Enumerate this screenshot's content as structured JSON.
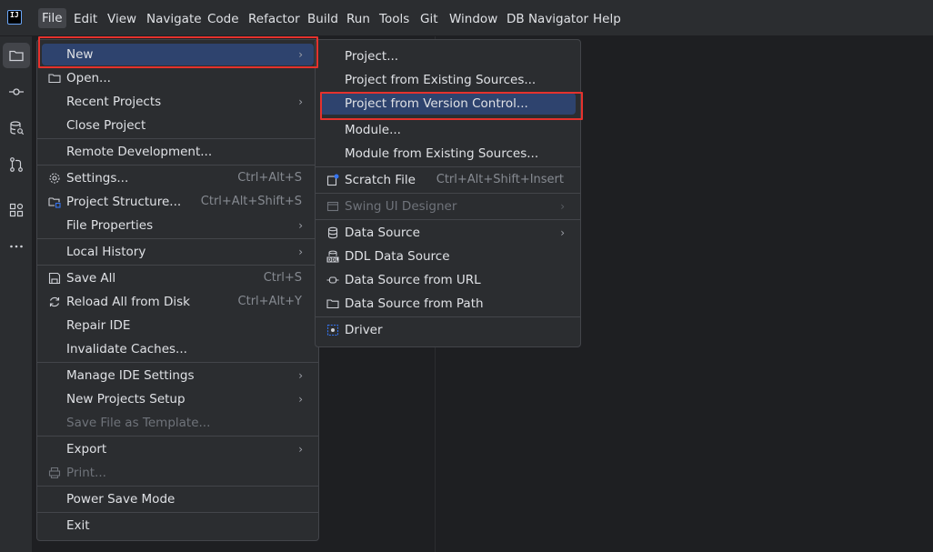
{
  "menubar": {
    "logo": "IJ",
    "items": [
      "File",
      "Edit",
      "View",
      "Navigate",
      "Code",
      "Refactor",
      "Build",
      "Run",
      "Tools",
      "Git",
      "Window",
      "DB Navigator",
      "Help"
    ]
  },
  "stripe": {
    "icons": [
      "folder-icon",
      "commit-icon",
      "database-search-icon",
      "pull-requests-icon",
      "structure-icon",
      "more-icon"
    ]
  },
  "file_menu": {
    "items": [
      {
        "label": "New",
        "submenu": true,
        "highlighted": true
      },
      {
        "label": "Open...",
        "icon": "folder-icon"
      },
      {
        "label": "Recent Projects",
        "submenu": true
      },
      {
        "label": "Close Project"
      },
      {
        "label": "Remote Development..."
      },
      {
        "label": "Settings...",
        "shortcut": "Ctrl+Alt+S",
        "icon": "gear-icon"
      },
      {
        "label": "Project Structure...",
        "shortcut": "Ctrl+Alt+Shift+S",
        "icon": "project-structure-icon"
      },
      {
        "label": "File Properties",
        "submenu": true
      },
      {
        "label": "Local History",
        "submenu": true
      },
      {
        "label": "Save All",
        "shortcut": "Ctrl+S",
        "icon": "save-icon"
      },
      {
        "label": "Reload All from Disk",
        "shortcut": "Ctrl+Alt+Y",
        "icon": "reload-icon"
      },
      {
        "label": "Repair IDE"
      },
      {
        "label": "Invalidate Caches..."
      },
      {
        "label": "Manage IDE Settings",
        "submenu": true
      },
      {
        "label": "New Projects Setup",
        "submenu": true
      },
      {
        "label": "Save File as Template...",
        "disabled": true
      },
      {
        "label": "Export",
        "submenu": true
      },
      {
        "label": "Print...",
        "disabled": true,
        "icon": "print-icon"
      },
      {
        "label": "Power Save Mode"
      },
      {
        "label": "Exit"
      }
    ]
  },
  "new_menu": {
    "items": [
      {
        "label": "Project..."
      },
      {
        "label": "Project from Existing Sources..."
      },
      {
        "label": "Project from Version Control...",
        "highlighted": true
      },
      {
        "label": "Module..."
      },
      {
        "label": "Module from Existing Sources..."
      },
      {
        "label": "Scratch File",
        "shortcut": "Ctrl+Alt+Shift+Insert",
        "icon": "scratch-file-icon"
      },
      {
        "label": "Swing UI Designer",
        "submenu": true,
        "disabled": true,
        "icon": "swing-designer-icon"
      },
      {
        "label": "Data Source",
        "submenu": true,
        "icon": "database-icon"
      },
      {
        "label": "DDL Data Source",
        "icon": "ddl-icon"
      },
      {
        "label": "Data Source from URL",
        "icon": "url-plug-icon"
      },
      {
        "label": "Data Source from Path",
        "icon": "folder-icon"
      },
      {
        "label": "Driver",
        "icon": "driver-icon"
      }
    ]
  },
  "colors": {
    "background": "#1e1f22",
    "panel": "#2b2d30",
    "highlight": "#2e436e",
    "annotation": "#e5322d"
  }
}
